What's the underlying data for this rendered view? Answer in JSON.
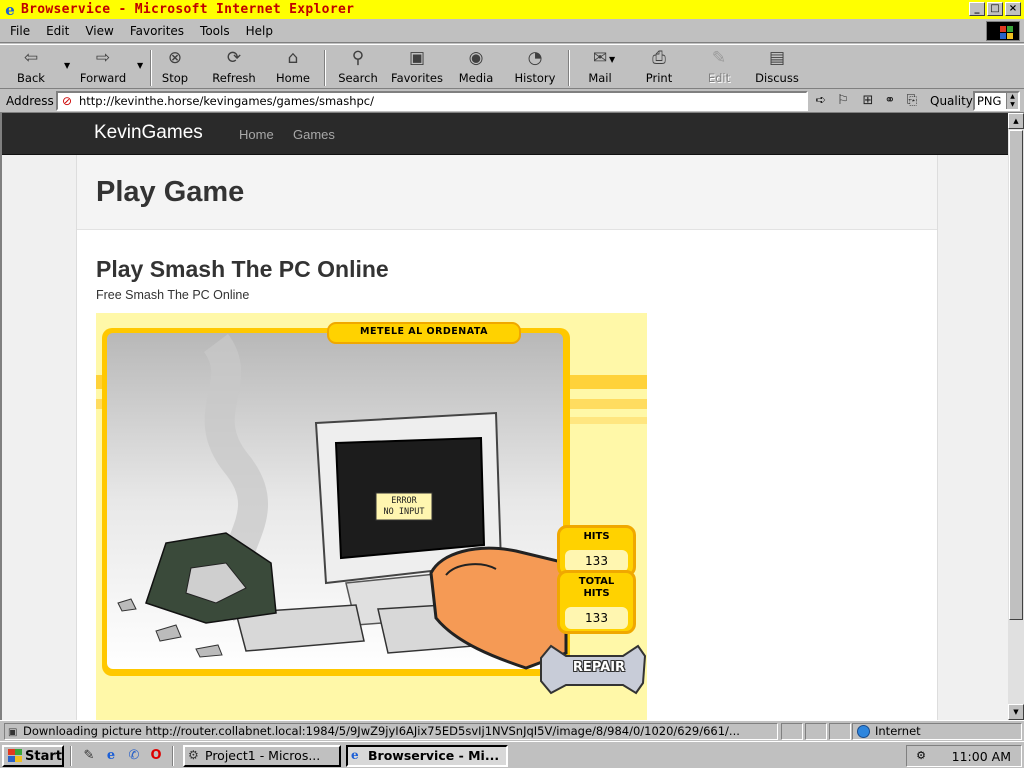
{
  "window": {
    "title": "Browservice - Microsoft Internet Explorer",
    "buttons": [
      "_",
      "□",
      "×"
    ]
  },
  "menu": [
    "File",
    "Edit",
    "View",
    "Favorites",
    "Tools",
    "Help"
  ],
  "toolbar": {
    "back": "Back",
    "forward": "Forward",
    "stop": "Stop",
    "refresh": "Refresh",
    "home": "Home",
    "search": "Search",
    "favorites": "Favorites",
    "media": "Media",
    "history": "History",
    "mail": "Mail",
    "print": "Print",
    "edit": "Edit",
    "discuss": "Discuss"
  },
  "address": {
    "label": "Address",
    "url": "http://kevinthe.horse/kevingames/games/smashpc/",
    "quality_label": "Quality",
    "quality_value": "PNG"
  },
  "site": {
    "brand": "KevinGames",
    "nav": [
      "Home",
      "Games"
    ],
    "heading": "Play Game",
    "game_title": "Play Smash The PC Online",
    "game_subtitle": "Free Smash The PC Online"
  },
  "game": {
    "banner": "METELE AL ORDENATA",
    "screen_text_1": "ERROR",
    "screen_text_2": "NO INPUT",
    "hits_label": "HITS",
    "hits_value": "133",
    "total_hits_label_1": "TOTAL",
    "total_hits_label_2": "HITS",
    "total_hits_value": "133",
    "repair_label": "REPAIR"
  },
  "status": {
    "text": "Downloading picture http://router.collabnet.local:1984/5/9JwZ9jyI6AJix75ED5svIj1NVSnJqI5V/image/8/984/0/1020/629/661/...",
    "zone": "Internet"
  },
  "taskbar": {
    "start": "Start",
    "tasks": [
      "Project1 - Micros...",
      "Browservice - Mi..."
    ],
    "clock": "11:00 AM"
  }
}
